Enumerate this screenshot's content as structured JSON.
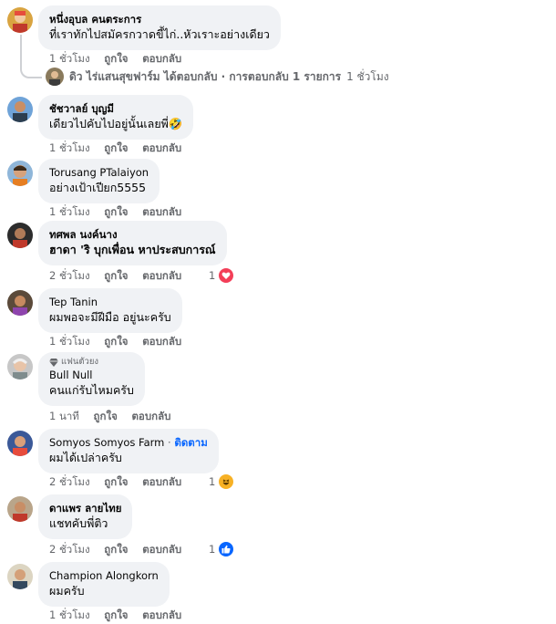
{
  "labels": {
    "like": "ถูกใจ",
    "reply": "ตอบกลับ"
  },
  "comments": [
    {
      "name": "หนึ่งอุบล คนตระการ",
      "text": "ที่เราทักไปสมัครกวาดขี้ไก่..หัวเราะอย่างเดียว",
      "time": "1 ชั่วโมง",
      "avatar": "person-avatar-1"
    },
    {
      "name": "ชัชวาลย์ บุญมี",
      "text": "เดียวไปคับไปอยู่นั้นเลยพี่🤣",
      "time": "1 ชั่วโมง",
      "avatar": "person-avatar-2"
    },
    {
      "name": "Torusang PTalaiyon",
      "text": "อย่างเป้าเปียก5555",
      "time": "1 ชั่วโมง",
      "avatar": "person-avatar-3"
    },
    {
      "name": "ทศพล นงค์นาง",
      "text": "ฮาดา 'ริ บุกเพื่อน หาประสบการณ์",
      "time": "2 ชั่วโมง",
      "avatar": "person-avatar-4",
      "reaction_count": "1",
      "reaction": "love"
    },
    {
      "name": "Tep Tanin",
      "text": "ผมพอจะมีฝีมือ อยู่นะครับ",
      "time": "1 ชั่วโมง",
      "avatar": "person-avatar-5"
    },
    {
      "name": "Bull Null",
      "badge": "แฟนตัวยง",
      "text": "คนแก่รับไหมครับ",
      "time": "1 นาที",
      "avatar": "person-avatar-6"
    },
    {
      "name": "Somyos Somyos Farm",
      "follow": "ติดตาม",
      "text": "ผมได้เปล่าครับ",
      "time": "2 ชั่วโมง",
      "avatar": "person-avatar-7",
      "reaction_count": "1",
      "reaction": "haha"
    },
    {
      "name": "ดาแพร ลายไทย",
      "text": "แชทคับพี่ติว",
      "time": "2 ชั่วโมง",
      "avatar": "person-avatar-8",
      "reaction_count": "1",
      "reaction": "like"
    },
    {
      "name": "Champion Alongkorn",
      "text": "ผมครับ",
      "time": "1 ชั่วโมง",
      "avatar": "person-avatar-9"
    }
  ],
  "reply_summary": {
    "author": "ดิว ไร่แสนสุขฟาร์ม",
    "action": "ได้ตอบกลับ",
    "separator": "·",
    "count_text": "การตอบกลับ 1 รายการ",
    "time": "1 ชั่วโมง"
  },
  "follow_separator": "·",
  "colors": {
    "bubble": "#f0f2f5",
    "meta": "#65676b",
    "link": "#0866ff",
    "love": "#f33e58",
    "like": "#0866ff",
    "haha": "#f7b125"
  }
}
